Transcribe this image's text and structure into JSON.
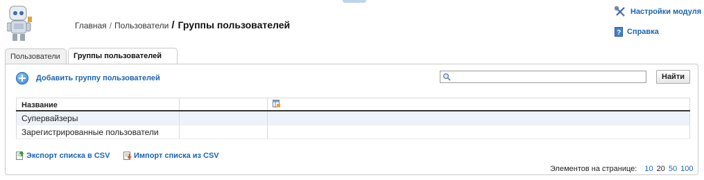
{
  "breadcrumb": {
    "home": "Главная",
    "sep1": "/",
    "users": "Пользователи",
    "sep2": "/",
    "current": "Группы пользователей"
  },
  "header_links": {
    "settings": "Настройки модуля",
    "help": "Справка"
  },
  "tabs": [
    {
      "label": "Пользователи",
      "active": false
    },
    {
      "label": "Группы пользователей",
      "active": true
    }
  ],
  "toolbar": {
    "add_group_label": "Добавить группу пользователей",
    "search_value": "",
    "find_label": "Найти"
  },
  "table": {
    "columns": [
      "Название",
      ""
    ],
    "rows": [
      {
        "name": "Супервайзеры"
      },
      {
        "name": "Зарегистрированные пользователи"
      }
    ]
  },
  "footer": {
    "export_label": "Экспорт списка в CSV",
    "import_label": "Импорт списка из CSV"
  },
  "pager": {
    "label": "Элементов на странице:",
    "options": [
      "10",
      "20",
      "50",
      "100"
    ],
    "current": "20"
  },
  "colors": {
    "link": "#1a64b4",
    "row_alt": "#eef3fb",
    "border": "#c9c9c9"
  },
  "icons": {
    "logo": "robot-mascot-icon",
    "settings": "tools-icon",
    "help": "help-book-icon",
    "add": "plus-circle-icon",
    "search": "magnifier-icon",
    "column_settings": "columns-icon",
    "export": "export-csv-icon",
    "import": "import-csv-icon"
  }
}
